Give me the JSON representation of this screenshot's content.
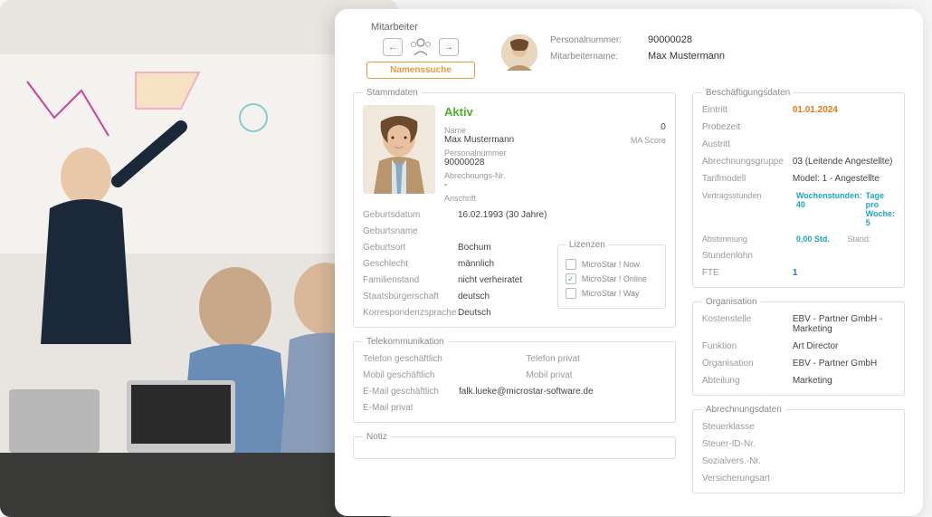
{
  "header": {
    "title": "Mitarbeiter",
    "search": "Namenssuche",
    "personalnr_label": "Personalnummer:",
    "personalnr_value": "90000028",
    "name_label": "Mitarbeitername:",
    "name_value": "Max Mustermann"
  },
  "stammdaten": {
    "legend": "Stammdaten",
    "status": "Aktiv",
    "name_label": "Name",
    "name_value": "Max Mustermann",
    "score_value": "0",
    "score_label": "MA Score",
    "pnr_label": "Personalnummer",
    "pnr_value": "90000028",
    "abrnr_label": "Abrechnungs-Nr.",
    "abrnr_value": "-",
    "anschrift_label": "Anschrift",
    "rows": [
      {
        "label": "Geburtsdatum",
        "value": "16.02.1993 (30 Jahre)"
      },
      {
        "label": "Geburtsname",
        "value": ""
      },
      {
        "label": "Geburtsort",
        "value": "Bochum"
      },
      {
        "label": "Geschlecht",
        "value": "männlich"
      },
      {
        "label": "Familienstand",
        "value": "nicht verheiratet"
      },
      {
        "label": "Staatsbürgerschaft",
        "value": "deutsch"
      },
      {
        "label": "Korrespondenzsprache",
        "value": "Deutsch"
      }
    ],
    "licenses": {
      "legend": "Lizenzen",
      "items": [
        {
          "label": "MicroStar ! Now",
          "checked": false
        },
        {
          "label": "MicroStar ! Online",
          "checked": true
        },
        {
          "label": "MicroStar ! Way",
          "checked": false
        }
      ]
    }
  },
  "telekom": {
    "legend": "Telekommunikation",
    "tel_g_label": "Telefon geschäftlich",
    "tel_p_label": "Telefon privat",
    "mob_g_label": "Mobil geschäftlich",
    "mob_p_label": "Mobil privat",
    "email_g_label": "E-Mail geschäftlich",
    "email_g_value": "falk.lueke@microstar-software.de",
    "email_p_label": "E-Mail privat"
  },
  "notiz": {
    "legend": "Notiz"
  },
  "beschaeftigung": {
    "legend": "Beschäftigungsdaten",
    "eintritt_label": "Eintritt",
    "eintritt_value": "01.01.2024",
    "probezeit_label": "Probezeit",
    "austritt_label": "Austritt",
    "abrgruppe_label": "Abrechnungsgruppe",
    "abrgruppe_value": "03 (Leitende Angestellte)",
    "tarif_label": "Tarifmodell",
    "tarif_value": "Model: 1 - Angestellte",
    "vertrag_label": "Vertragsstunden",
    "wochenstd": "Wochenstunden: 40",
    "tageprowoche": "Tage pro Woche: 5",
    "abstimmung_label": "Abstimmung",
    "abstimmung_value": "0,00 Std.",
    "stand_label": "Stand:",
    "stundenlohn_label": "Stundenlohn",
    "fte_label": "FTE",
    "fte_value": "1"
  },
  "organisation": {
    "legend": "Organisation",
    "kostenstelle_label": "Kostenstelle",
    "kostenstelle_value": "EBV - Partner GmbH - Marketing",
    "funktion_label": "Funktion",
    "funktion_value": "Art Director",
    "org_label": "Organisation",
    "org_value": "EBV - Partner GmbH",
    "abteilung_label": "Abteilung",
    "abteilung_value": "Marketing"
  },
  "abrechnung": {
    "legend": "Abrechnungsdaten",
    "steuerklasse_label": "Steuerklasse",
    "steuerid_label": "Steuer-ID-Nr.",
    "sozialvers_label": "Sozialvers.-Nr.",
    "versart_label": "Versicherungsart"
  }
}
